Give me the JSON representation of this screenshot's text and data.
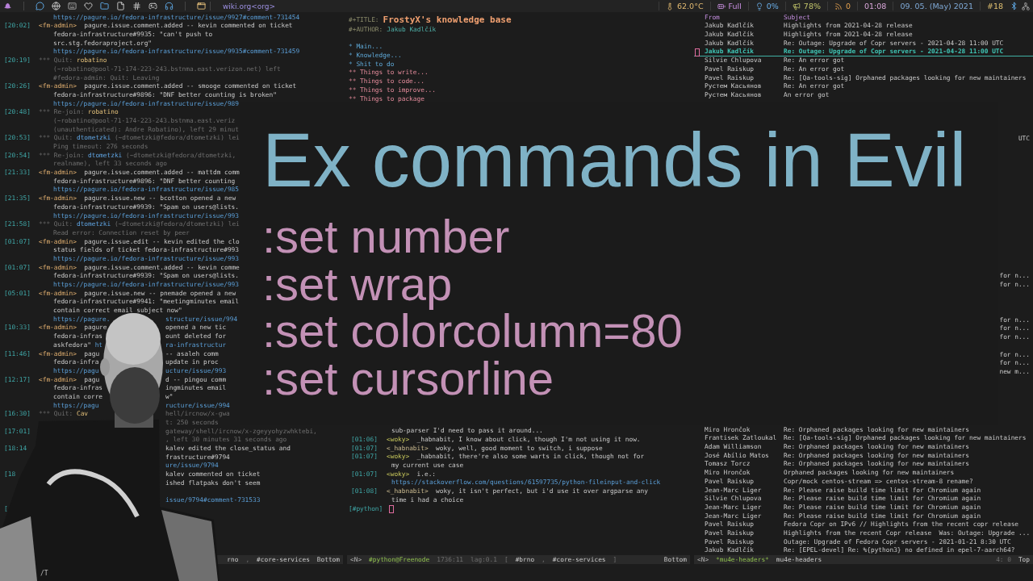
{
  "top_bar": {
    "location": "wiki.org<org>",
    "indicators": [
      {
        "kind": "temperature",
        "text": "62.0°C"
      },
      {
        "kind": "battery",
        "text": "Full"
      },
      {
        "kind": "light",
        "text": "0%"
      },
      {
        "kind": "volume",
        "text": "78%"
      },
      {
        "kind": "feeds",
        "text": "0"
      },
      {
        "kind": "time",
        "text": "01:08"
      },
      {
        "kind": "date",
        "text": "09. 05. (May) 2021"
      },
      {
        "kind": "workspace",
        "text": "#18"
      }
    ]
  },
  "irc_log": {
    "lines": [
      {
        "kind": "cont",
        "parts": [
          {
            "kind": "link",
            "text": "https://pagure.io/fedora-infrastructure/issue/9927#comment-731454"
          }
        ]
      },
      {
        "kind": "msg",
        "time": "[20:02]",
        "parts": [
          {
            "kind": "nick",
            "text": "<fm-admin>"
          },
          {
            "kind": "text",
            "text": "pagure.issue.comment.added -- kevin commented on ticket"
          }
        ]
      },
      {
        "kind": "cont",
        "parts": [
          {
            "kind": "text",
            "text": "fedora-infrastructure#9935: \"can't push to"
          }
        ]
      },
      {
        "kind": "cont",
        "parts": [
          {
            "kind": "text",
            "text": "src.stg.fedoraproject.org\""
          }
        ]
      },
      {
        "kind": "cont",
        "parts": [
          {
            "kind": "link",
            "text": "https://pagure.io/fedora-infrastructure/issue/9935#comment-731459"
          }
        ]
      },
      {
        "kind": "msg",
        "time": "[20:19]",
        "parts": [
          {
            "kind": "dim",
            "text": "*** Quit:"
          },
          {
            "kind": "user_a",
            "text": "robatino"
          }
        ]
      },
      {
        "kind": "cont",
        "parts": [
          {
            "kind": "dim",
            "text": "(~robatino@pool-71-174-223-243.bstnma.east.verizon.net) left"
          }
        ]
      },
      {
        "kind": "cont",
        "parts": [
          {
            "kind": "dim",
            "text": "#fedora-admin: Quit: Leaving"
          }
        ]
      },
      {
        "kind": "msg",
        "time": "[20:26]",
        "parts": [
          {
            "kind": "nick",
            "text": "<fm-admin>"
          },
          {
            "kind": "text",
            "text": "pagure.issue.comment.added -- smooge commented on ticket"
          }
        ]
      },
      {
        "kind": "cont",
        "parts": [
          {
            "kind": "text",
            "text": "fedora-infrastructure#9896: \"DNF better counting is broken\""
          }
        ]
      },
      {
        "kind": "cont",
        "parts": [
          {
            "kind": "link",
            "text": "https://pagure.io/fedora-infrastructure/issue/989"
          }
        ]
      },
      {
        "kind": "msg",
        "time": "[20:48]",
        "parts": [
          {
            "kind": "dim",
            "text": "*** Re-join:"
          },
          {
            "kind": "user_a",
            "text": "robatino"
          }
        ]
      },
      {
        "kind": "cont",
        "parts": [
          {
            "kind": "dim",
            "text": "(~robatino@pool-71-174-223-243.bstnma.east.veriz"
          }
        ]
      },
      {
        "kind": "cont",
        "parts": [
          {
            "kind": "dim",
            "text": "(unauthenticated): Andre Robatino), left 29 minut"
          }
        ]
      },
      {
        "kind": "msg",
        "time": "[20:53]",
        "parts": [
          {
            "kind": "dim",
            "text": "*** Quit:"
          },
          {
            "kind": "user_b",
            "text": "dtometzki"
          },
          {
            "kind": "dim",
            "text": "(~dtometzki@fedora/dtometzki) lei"
          }
        ]
      },
      {
        "kind": "cont",
        "parts": [
          {
            "kind": "dim",
            "text": "Ping timeout: 276 seconds"
          }
        ]
      },
      {
        "kind": "msg",
        "time": "[20:54]",
        "parts": [
          {
            "kind": "dim",
            "text": "*** Re-join:"
          },
          {
            "kind": "user_b",
            "text": "dtometzki"
          },
          {
            "kind": "dim",
            "text": "(~dtometzki@fedora/dtometzki,"
          }
        ]
      },
      {
        "kind": "cont",
        "parts": [
          {
            "kind": "dim",
            "text": "realname), left 33 seconds ago"
          }
        ]
      },
      {
        "kind": "msg",
        "time": "[21:33]",
        "parts": [
          {
            "kind": "nick",
            "text": "<fm-admin>"
          },
          {
            "kind": "text",
            "text": "pagure.issue.comment.added -- mattdm comm"
          }
        ]
      },
      {
        "kind": "cont",
        "parts": [
          {
            "kind": "text",
            "text": "fedora-infrastructure#9896: \"DNF better counting"
          }
        ]
      },
      {
        "kind": "cont",
        "parts": [
          {
            "kind": "link",
            "text": "https://pagure.io/fedora-infrastructure/issue/985"
          }
        ]
      },
      {
        "kind": "msg",
        "time": "[21:35]",
        "parts": [
          {
            "kind": "nick",
            "text": "<fm-admin>"
          },
          {
            "kind": "text",
            "text": "pagure.issue.new -- bcotton opened a new"
          }
        ]
      },
      {
        "kind": "cont",
        "parts": [
          {
            "kind": "text",
            "text": "fedora-infrastructure#9939: \"Spam on users@lists."
          }
        ]
      },
      {
        "kind": "cont",
        "parts": [
          {
            "kind": "link",
            "text": "https://pagure.io/fedora-infrastructure/issue/993"
          }
        ]
      },
      {
        "kind": "msg",
        "time": "[21:58]",
        "parts": [
          {
            "kind": "dim",
            "text": "*** Quit:"
          },
          {
            "kind": "user_b",
            "text": "dtometzki"
          },
          {
            "kind": "dim",
            "text": "(~dtometzki@fedora/dtometzki) lei"
          }
        ]
      },
      {
        "kind": "cont",
        "parts": [
          {
            "kind": "dim",
            "text": "Read error: Connection reset by peer"
          }
        ]
      },
      {
        "kind": "msg",
        "time": "[01:07]",
        "parts": [
          {
            "kind": "nick",
            "text": "<fm-admin>"
          },
          {
            "kind": "text",
            "text": "pagure.issue.edit -- kevin edited the clo"
          }
        ]
      },
      {
        "kind": "cont",
        "parts": [
          {
            "kind": "text",
            "text": "status fields of ticket fedora-infrastructure#993"
          }
        ]
      },
      {
        "kind": "cont",
        "parts": [
          {
            "kind": "link",
            "text": "https://pagure.io/fedora-infrastructure/issue/993"
          }
        ]
      },
      {
        "kind": "msg",
        "time": "[01:07]",
        "parts": [
          {
            "kind": "nick",
            "text": "<fm-admin>"
          },
          {
            "kind": "text",
            "text": "pagure.issue.comment.added -- kevin comme"
          }
        ]
      },
      {
        "kind": "cont",
        "parts": [
          {
            "kind": "text",
            "text": "fedora-infrastructure#9939: \"Spam on users@lists."
          }
        ]
      },
      {
        "kind": "cont",
        "parts": [
          {
            "kind": "link",
            "text": "https://pagure.io/fedora-infrastructure/issue/993"
          }
        ]
      },
      {
        "kind": "msg",
        "time": "[05:01]",
        "parts": [
          {
            "kind": "nick",
            "text": "<fm-admin>"
          },
          {
            "kind": "text",
            "text": "pagure.issue.new -- pnemade opened a new"
          }
        ]
      },
      {
        "kind": "cont",
        "parts": [
          {
            "kind": "text",
            "text": "fedora-infrastructure#9941: \"meetingminutes email"
          }
        ]
      },
      {
        "kind": "cont",
        "parts": [
          {
            "kind": "text",
            "text": "contain correct email subject now\""
          }
        ]
      },
      {
        "kind": "cont",
        "parts": [
          {
            "kind": "link",
            "text": "https://pagure."
          }
        ],
        "tail": [
          {
            "kind": "link",
            "text": "structure/issue/994"
          }
        ]
      },
      {
        "kind": "msg",
        "time": "[10:33]",
        "parts": [
          {
            "kind": "nick",
            "text": "<fm-admin>"
          },
          {
            "kind": "text",
            "text": "pagure"
          }
        ],
        "tail": [
          {
            "kind": "text",
            "text": "opened a new tic"
          }
        ]
      },
      {
        "kind": "cont",
        "parts": [
          {
            "kind": "text",
            "text": "fedora-infras"
          }
        ],
        "tail": [
          {
            "kind": "text",
            "text": "ount deleted for"
          }
        ]
      },
      {
        "kind": "cont",
        "parts": [
          {
            "kind": "text",
            "text": "askfedora\""
          },
          {
            "kind": "link",
            "text": "ht"
          }
        ],
        "tail": [
          {
            "kind": "link",
            "text": "ra-infrastructur"
          }
        ]
      },
      {
        "kind": "msg",
        "time": "[11:46]",
        "parts": [
          {
            "kind": "nick",
            "text": "<fm-admin>"
          },
          {
            "kind": "text",
            "text": "pagu"
          }
        ],
        "tail": [
          {
            "kind": "text",
            "text": "-- asaleh comm"
          }
        ]
      },
      {
        "kind": "cont",
        "parts": [
          {
            "kind": "text",
            "text": "fedora-infra"
          }
        ],
        "tail": [
          {
            "kind": "text",
            "text": "update in proc"
          }
        ]
      },
      {
        "kind": "cont",
        "parts": [
          {
            "kind": "link",
            "text": "https://pagu"
          }
        ],
        "tail": [
          {
            "kind": "link",
            "text": "ucture/issue/993"
          }
        ]
      },
      {
        "kind": "msg",
        "time": "[12:17]",
        "parts": [
          {
            "kind": "nick",
            "text": "<fm-admin>"
          },
          {
            "kind": "text",
            "text": "pagu"
          }
        ],
        "tail": [
          {
            "kind": "text",
            "text": "d -- pingou comm"
          }
        ]
      },
      {
        "kind": "cont",
        "parts": [
          {
            "kind": "text",
            "text": "fedora-infras"
          }
        ],
        "tail": [
          {
            "kind": "text",
            "text": "ingminutes email"
          }
        ]
      },
      {
        "kind": "cont",
        "parts": [
          {
            "kind": "text",
            "text": "contain corre"
          }
        ],
        "tail": [
          {
            "kind": "text",
            "text": "w\""
          }
        ]
      },
      {
        "kind": "cont",
        "parts": [
          {
            "kind": "link",
            "text": "https://pagu"
          }
        ],
        "tail": [
          {
            "kind": "link",
            "text": "ructure/issue/994"
          }
        ]
      },
      {
        "kind": "msg",
        "time": "[16:30]",
        "parts": [
          {
            "kind": "dim",
            "text": "*** Quit:"
          },
          {
            "kind": "user_a",
            "text": "Cav"
          }
        ],
        "tail": [
          {
            "kind": "dim",
            "text": "hell/ircnow/x-gwa"
          }
        ]
      },
      {
        "kind": "cont",
        "tail": [
          {
            "kind": "dim",
            "text": "t: 250 seconds"
          }
        ]
      },
      {
        "kind": "msg",
        "time": "[17:01]",
        "tail": [
          {
            "kind": "dim",
            "text": "gateway/shell/ircnow/x-zgeyyohyzwhktebi,"
          }
        ]
      },
      {
        "kind": "cont",
        "tail": [
          {
            "kind": "dim",
            "text": ", left 30 minutes 31 seconds ago"
          }
        ]
      },
      {
        "kind": "msg",
        "time": "[18:14",
        "tail": [
          {
            "kind": "text",
            "text": "kalev edited the close_status and"
          }
        ]
      },
      {
        "kind": "cont",
        "tail": [
          {
            "kind": "text",
            "text": "frastructure#9794"
          }
        ]
      },
      {
        "kind": "cont",
        "tail": [
          {
            "kind": "link",
            "text": "ure/issue/9794"
          }
        ]
      },
      {
        "kind": "msg",
        "time": "[18",
        "tail": [
          {
            "kind": "text",
            "text": "kalev commented on ticket"
          }
        ]
      },
      {
        "kind": "cont",
        "tail": [
          {
            "kind": "text",
            "text": "ished flatpaks don't seem"
          }
        ]
      },
      {
        "kind": "blank"
      },
      {
        "kind": "cont",
        "tail": [
          {
            "kind": "link",
            "text": "issue/9794#comment-731533"
          }
        ]
      },
      {
        "kind": "msg",
        "time": "["
      }
    ],
    "status": {
      "right": [
        {
          "kind": "text",
          "text": "rno"
        },
        {
          "kind": "dim",
          "text": ","
        },
        {
          "kind": "text",
          "text": "#core-services"
        },
        {
          "kind": "text",
          "text": "Bottom"
        }
      ]
    },
    "echo": "/T"
  },
  "org_file": {
    "title_keyword": "#+TITLE:",
    "title": "FrostyX's knowledge base",
    "author_keyword": "#+AUTHOR:",
    "author": "Jakub Kadlčík",
    "headings": [
      {
        "text": "* Main..."
      },
      {
        "text": "* Knowledge..."
      },
      {
        "text": "* Shit to do",
        "children": [
          {
            "text": "** Things to write..."
          },
          {
            "text": "** Things to code..."
          },
          {
            "text": "** Things to improve..."
          },
          {
            "text": "** Things to package"
          }
        ]
      }
    ]
  },
  "python_chat": {
    "lines": [
      {
        "kind": "cont",
        "parts": [
          {
            "kind": "text",
            "text": "sub-parser I'd need to pass it around..."
          }
        ]
      },
      {
        "kind": "msg",
        "time": "[01:06]",
        "parts": [
          {
            "kind": "nick_a",
            "text": "<woky>"
          },
          {
            "kind": "text",
            "text": "_habnabit, I know about click, though I'm not using it now."
          }
        ]
      },
      {
        "kind": "msg",
        "time": "[01:07]",
        "parts": [
          {
            "kind": "nick_b",
            "text": "<_habnabit>"
          },
          {
            "kind": "text",
            "text": "woky, well, good moment to switch, i suppose"
          }
        ]
      },
      {
        "kind": "msg",
        "time": "[01:07]",
        "parts": [
          {
            "kind": "nick_a",
            "text": "<woky>"
          },
          {
            "kind": "text",
            "text": "_habnabit, there're also some warts in click, though not for"
          }
        ]
      },
      {
        "kind": "cont",
        "parts": [
          {
            "kind": "text",
            "text": "my current use case"
          }
        ]
      },
      {
        "kind": "msg",
        "time": "[01:07]",
        "parts": [
          {
            "kind": "nick_a",
            "text": "<woky>"
          },
          {
            "kind": "text",
            "text": "i.e.:"
          }
        ]
      },
      {
        "kind": "cont",
        "parts": [
          {
            "kind": "link",
            "text": "https://stackoverflow.com/questions/61597735/python-fileinput-and-click"
          }
        ]
      },
      {
        "kind": "msg",
        "time": "[01:08]",
        "parts": [
          {
            "kind": "nick_b",
            "text": "<_habnabit>"
          },
          {
            "kind": "text",
            "text": "woky, it isn't perfect, but i'd use it over argparse any"
          }
        ]
      },
      {
        "kind": "cont",
        "parts": [
          {
            "kind": "text",
            "text": "time i had a choice"
          }
        ]
      }
    ],
    "prompt": "[#python]",
    "status": {
      "left": [
        {
          "kind": "mode",
          "text": "<N>"
        },
        {
          "kind": "buffer",
          "text": "#python@Freenode"
        },
        {
          "kind": "dim",
          "text": "1736:11"
        },
        {
          "kind": "dim",
          "text": "lag:0.1"
        },
        {
          "kind": "dim",
          "text": "["
        },
        {
          "kind": "text",
          "text": "#brno"
        },
        {
          "kind": "dim",
          "text": ","
        },
        {
          "kind": "text",
          "text": "#core-services"
        },
        {
          "kind": "dim",
          "text": "]"
        }
      ],
      "right": [
        {
          "kind": "text",
          "text": "Bottom"
        }
      ]
    }
  },
  "mail_headers": {
    "columns": [
      "From",
      "Subject"
    ],
    "top_rows": [
      {
        "from": "Jakub Kadlčík",
        "subject": "Highlights from 2021-04-28 release",
        "selected": false
      },
      {
        "from": "Jakub Kadlčík",
        "subject": "Highlights from 2021-04-28 release",
        "selected": false
      },
      {
        "from": "Jakub Kadlčík",
        "subject": "Re: Outage: Upgrade of Copr servers - 2021-04-28 11:00 UTC",
        "selected": false
      },
      {
        "from": "Jakub Kadlčík",
        "subject": "Re: Outage: Upgrade of Copr servers - 2021-04-28 11:00 UTC",
        "selected": true
      },
      {
        "from": "Silvie Chlupova",
        "subject": "Re: An error got",
        "selected": false
      },
      {
        "from": "Pavel Raiskup",
        "subject": "Re: An error got",
        "selected": false
      },
      {
        "from": "Pavel Raiskup",
        "subject": "Re: [Qa-tools-sig] Orphaned packages looking for new maintainers",
        "selected": false
      },
      {
        "from": "Рустем Касьянов",
        "subject": "Re: An error got",
        "selected": false
      },
      {
        "from": "Рустем Касьянов",
        "subject": "An error got",
        "selected": false
      }
    ],
    "subject_ends": [
      [
        "UTC"
      ],
      [
        "for n...",
        "for n..."
      ],
      [
        "for n...",
        "for n...",
        "for n..."
      ],
      [
        "for n...",
        "for n...",
        "new m..."
      ]
    ],
    "bottom_rows": [
      {
        "from": "Miro Hrončok",
        "subject": "Re: Orphaned packages looking for new maintainers",
        "selected": false
      },
      {
        "from": "Frantisek Zatloukal",
        "subject": "Re: [Qa-tools-sig] Orphaned packages looking for new maintainers",
        "selected": false
      },
      {
        "from": "Adam Williamson",
        "subject": "Re: Orphaned packages looking for new maintainers",
        "selected": false
      },
      {
        "from": "José Abílio Matos",
        "subject": "Re: Orphaned packages looking for new maintainers",
        "selected": false
      },
      {
        "from": "Tomasz Torcz",
        "subject": "Re: Orphaned packages looking for new maintainers",
        "selected": false
      },
      {
        "from": "Miro Hrončok",
        "subject": "Orphaned packages looking for new maintainers",
        "selected": false
      },
      {
        "from": "Pavel Raiskup",
        "subject": "Copr/mock centos-stream => centos-stream-8 rename?",
        "selected": false
      },
      {
        "from": "Jean-Marc Liger",
        "subject": "Re: Please raise build time limit for Chromium again",
        "selected": false
      },
      {
        "from": "Silvie Chlupova",
        "subject": "Re: Please raise build time limit for Chromium again",
        "selected": false
      },
      {
        "from": "Jean-Marc Liger",
        "subject": "Re: Please raise build time limit for Chromium again",
        "selected": false
      },
      {
        "from": "Jean-Marc Liger",
        "subject": "Re: Please raise build time limit for Chromium again",
        "selected": false
      },
      {
        "from": "Pavel Raiskup",
        "subject": "Fedora Copr on IPv6 // Highlights from the recent copr release",
        "selected": false
      },
      {
        "from": "Pavel Raiskup",
        "subject": "Highlights from the recent Copr release  Was: Outage: Upgrade ...",
        "selected": false
      },
      {
        "from": "Pavel Raiskup",
        "subject": "Outage: Upgrade of Fedora Copr servers - 2021-01-21 8:30 UTC",
        "selected": false
      },
      {
        "from": "Jakub Kadlčík",
        "subject": "Re: [EPEL-devel] Re: %{python3} no defined in epel-7-aarch64?",
        "selected": false
      }
    ],
    "status": {
      "left": [
        {
          "kind": "mode",
          "text": "<N>"
        },
        {
          "kind": "buffer",
          "text": "*mu4e-headers*"
        },
        {
          "kind": "text",
          "text": "mu4e-headers"
        }
      ],
      "right": [
        {
          "kind": "dim",
          "text": "4: 0"
        },
        {
          "kind": "text",
          "text": "Top"
        }
      ]
    }
  },
  "title_card": {
    "title": "Ex commands in Evil",
    "commands": [
      ":set number",
      ":set wrap",
      ":set colorcolumn=80",
      ":set cursorline"
    ]
  }
}
